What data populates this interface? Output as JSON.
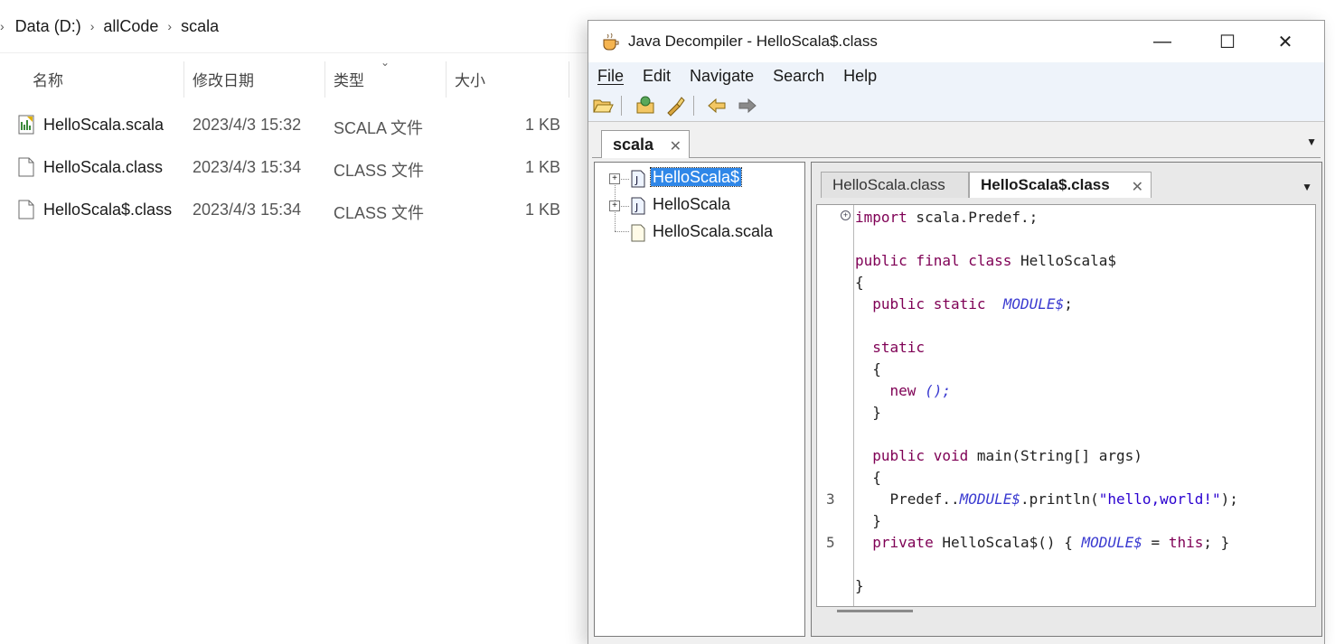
{
  "explorer": {
    "breadcrumb": [
      "Data (D:)",
      "allCode",
      "scala"
    ],
    "columns": {
      "name": "名称",
      "modified": "修改日期",
      "type": "类型",
      "size": "大小"
    },
    "files": [
      {
        "name": "HelloScala.scala",
        "modified": "2023/4/3 15:32",
        "type": "SCALA 文件",
        "size": "1 KB",
        "icon": "scala-file-icon"
      },
      {
        "name": "HelloScala.class",
        "modified": "2023/4/3 15:34",
        "type": "CLASS 文件",
        "size": "1 KB",
        "icon": "file-icon"
      },
      {
        "name": "HelloScala$.class",
        "modified": "2023/4/3 15:34",
        "type": "CLASS 文件",
        "size": "1 KB",
        "icon": "file-icon"
      }
    ]
  },
  "decompiler": {
    "title": "Java Decompiler - HelloScala$.class",
    "menu": [
      "File",
      "Edit",
      "Navigate",
      "Search",
      "Help"
    ],
    "outer_tab": "scala",
    "tree": [
      {
        "label": "HelloScala$",
        "selected": true
      },
      {
        "label": "HelloScala",
        "selected": false
      },
      {
        "label": "HelloScala.scala",
        "selected": false
      }
    ],
    "editor_tabs": [
      {
        "label": "HelloScala.class",
        "active": false
      },
      {
        "label": "HelloScala$.class",
        "active": true
      }
    ],
    "line_numbers": {
      "n3": "3",
      "n5": "5"
    },
    "code": {
      "l1a": "import",
      "l1b": " scala.Predef.;",
      "l2a": "public final class",
      "l2b": " HelloScala$",
      "l3": "{",
      "l4a": "public static",
      "l4b": "MODULE$",
      "l4c": ";",
      "l5": "static",
      "l6": "{",
      "l7a": "new",
      "l7b": " ();",
      "l8": "}",
      "l9a": "public void",
      "l9b": " main(String[] args)",
      "l10": "{",
      "l11a": "Predef..",
      "l11b": "MODULE$",
      "l11c": ".println(",
      "l11d": "\"hello,world!\"",
      "l11e": ");",
      "l12": "}",
      "l13a": "private",
      "l13b": " HelloScala$() { ",
      "l13c": "MODULE$",
      "l13d": " = ",
      "l13e": "this",
      "l13f": "; }",
      "l14": "}"
    }
  }
}
